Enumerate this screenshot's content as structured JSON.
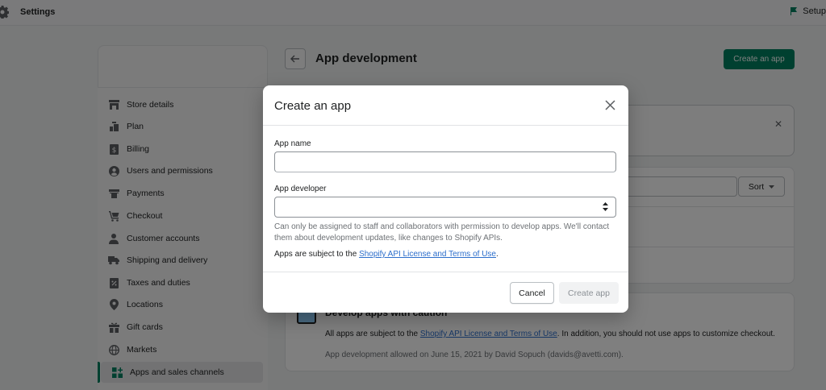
{
  "topbar": {
    "title": "Settings",
    "setup_label": "Setup"
  },
  "sidebar": {
    "items": [
      {
        "label": "Store details",
        "icon": "store-icon"
      },
      {
        "label": "Plan",
        "icon": "plan-icon"
      },
      {
        "label": "Billing",
        "icon": "billing-icon"
      },
      {
        "label": "Users and permissions",
        "icon": "user-icon"
      },
      {
        "label": "Payments",
        "icon": "payments-icon"
      },
      {
        "label": "Checkout",
        "icon": "cart-icon"
      },
      {
        "label": "Customer accounts",
        "icon": "customer-icon"
      },
      {
        "label": "Shipping and delivery",
        "icon": "truck-icon"
      },
      {
        "label": "Taxes and duties",
        "icon": "taxes-icon"
      },
      {
        "label": "Locations",
        "icon": "location-icon"
      },
      {
        "label": "Gift cards",
        "icon": "gift-icon"
      },
      {
        "label": "Markets",
        "icon": "globe-icon"
      },
      {
        "label": "Apps and sales channels",
        "icon": "apps-icon",
        "active": true
      }
    ]
  },
  "page": {
    "title": "App development",
    "create_app_label": "Create an app",
    "sort_label": "Sort"
  },
  "caution": {
    "title": "Develop apps with caution",
    "line1_prefix": "All apps are subject to the ",
    "line1_link": "Shopify API License and Terms of Use",
    "line1_suffix": ". In addition, you should not use apps to customize checkout.",
    "line2": "App development allowed on June 15, 2021 by David Sopuch (davids@avetti.com)."
  },
  "modal": {
    "title": "Create an app",
    "app_name_label": "App name",
    "app_name_value": "",
    "app_developer_label": "App developer",
    "app_developer_value": "",
    "help_text": "Can only be assigned to staff and collaborators with permission to develop apps. We'll contact them about development updates, like changes to Shopify APIs.",
    "terms_prefix": "Apps are subject to the ",
    "terms_link": "Shopify API License and Terms of Use",
    "terms_suffix": ".",
    "cancel_label": "Cancel",
    "create_label": "Create app"
  },
  "colors": {
    "primary": "#008060",
    "link": "#2c6ecb",
    "overlay": "rgba(0,0,0,0.5)"
  }
}
